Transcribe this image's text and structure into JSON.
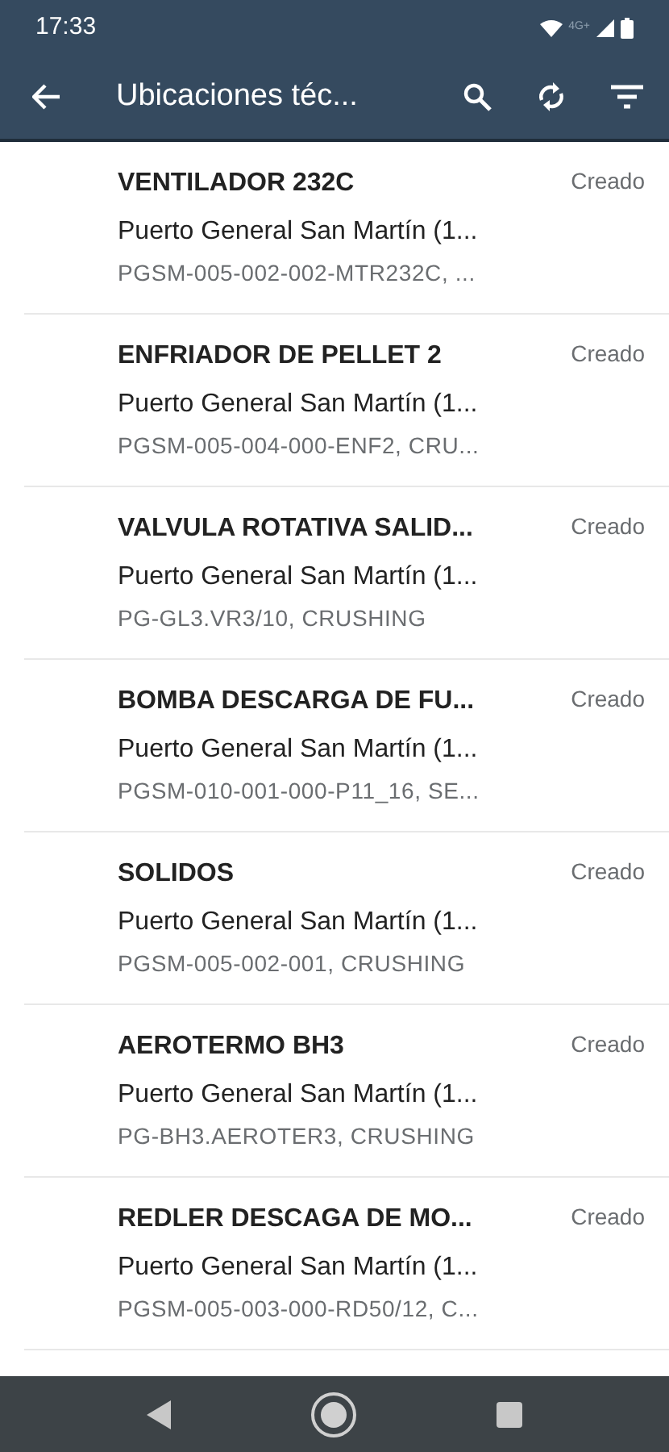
{
  "status_bar": {
    "time": "17:33",
    "network_label": "4G+"
  },
  "app_bar": {
    "title": "Ubicaciones téc..."
  },
  "items": [
    {
      "title": "VENTILADOR 232C",
      "location": "Puerto General San Martín (1...",
      "code": "PGSM-005-002-002-MTR232C, ...",
      "status": "Creado"
    },
    {
      "title": "ENFRIADOR DE PELLET 2",
      "location": "Puerto General San Martín (1...",
      "code": "PGSM-005-004-000-ENF2, CRU...",
      "status": "Creado"
    },
    {
      "title": "VALVULA ROTATIVA SALID...",
      "location": "Puerto General San Martín (1...",
      "code": "PG-GL3.VR3/10, CRUSHING",
      "status": "Creado"
    },
    {
      "title": "BOMBA DESCARGA DE FU...",
      "location": "Puerto General San Martín (1...",
      "code": "PGSM-010-001-000-P11_16, SE...",
      "status": "Creado"
    },
    {
      "title": "SOLIDOS",
      "location": "Puerto General San Martín (1...",
      "code": "PGSM-005-002-001, CRUSHING",
      "status": "Creado"
    },
    {
      "title": "AEROTERMO BH3",
      "location": "Puerto General San Martín (1...",
      "code": "PG-BH3.AEROTER3, CRUSHING",
      "status": "Creado"
    },
    {
      "title": "REDLER DESCAGA DE MO...",
      "location": "Puerto General San Martín (1...",
      "code": "PGSM-005-003-000-RD50/12, C...",
      "status": "Creado"
    }
  ]
}
